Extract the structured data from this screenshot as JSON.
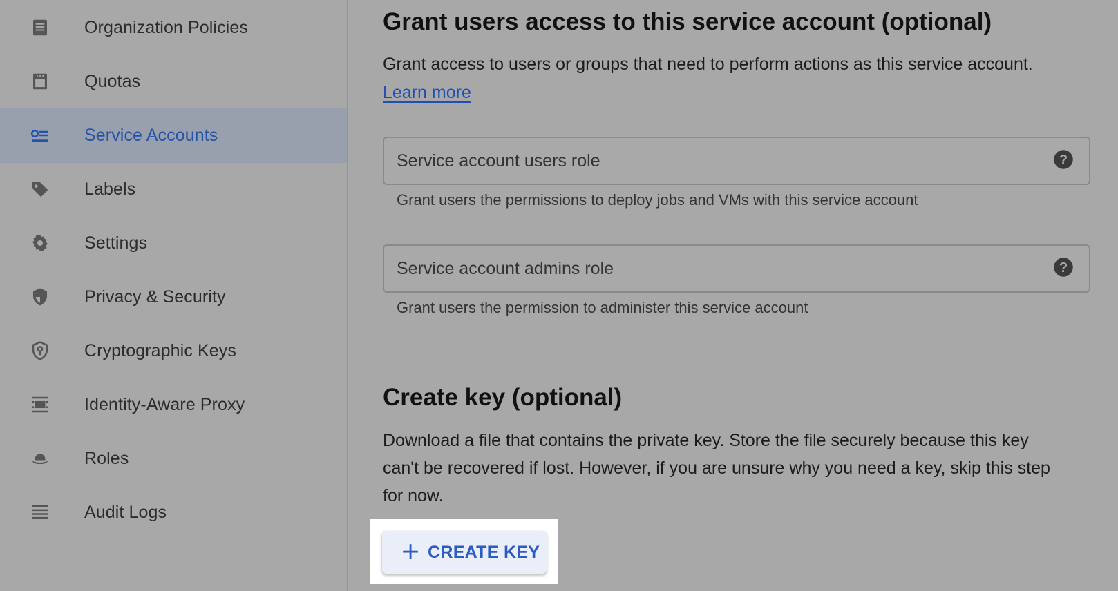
{
  "sidebar": {
    "items": [
      {
        "label": "Organization Policies",
        "icon": "policy-doc-icon"
      },
      {
        "label": "Quotas",
        "icon": "quota-icon"
      },
      {
        "label": "Service Accounts",
        "icon": "service-account-icon",
        "active": true
      },
      {
        "label": "Labels",
        "icon": "label-tag-icon"
      },
      {
        "label": "Settings",
        "icon": "gear-icon"
      },
      {
        "label": "Privacy & Security",
        "icon": "shield-icon"
      },
      {
        "label": "Cryptographic Keys",
        "icon": "key-shield-icon"
      },
      {
        "label": "Identity-Aware Proxy",
        "icon": "proxy-icon"
      },
      {
        "label": "Roles",
        "icon": "hat-icon"
      },
      {
        "label": "Audit Logs",
        "icon": "list-icon"
      }
    ]
  },
  "grant": {
    "title": "Grant users access to this service account (optional)",
    "description": "Grant access to users or groups that need to perform actions as this service account.",
    "learn_more": "Learn more",
    "users_role": {
      "label": "Service account users role",
      "hint": "Grant users the permissions to deploy jobs and VMs with this service account"
    },
    "admins_role": {
      "label": "Service account admins role",
      "hint": "Grant users the permission to administer this service account"
    }
  },
  "create_key": {
    "title": "Create key (optional)",
    "lines": [
      "Download a file that contains the private key. Store the file securely because this key",
      "can't be recovered if lost. However, if you are unsure why you need a key, skip this step",
      "for now."
    ],
    "button_label": "CREATE KEY"
  },
  "colors": {
    "accent": "#2d5bc4",
    "active_nav_bg": "#98a0ae",
    "highlight": "#ffffff"
  }
}
